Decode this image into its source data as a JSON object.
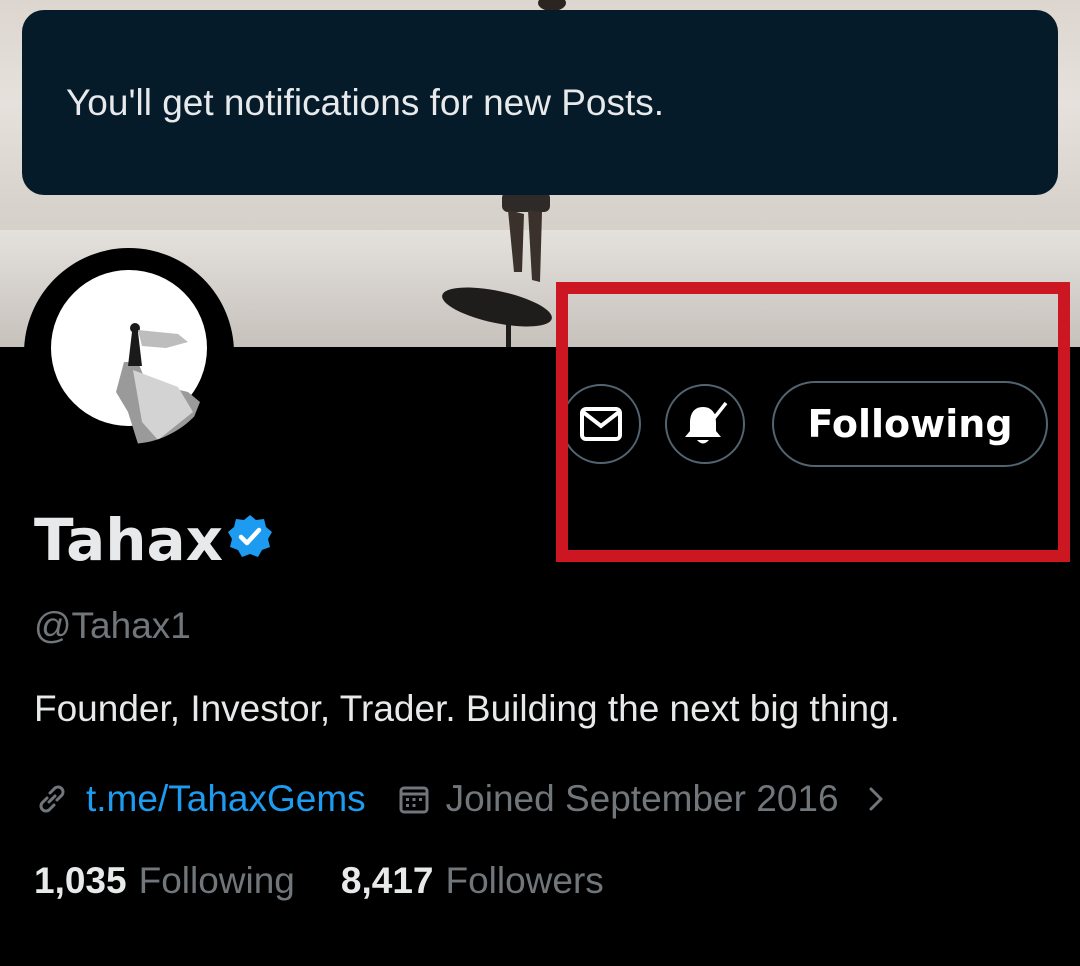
{
  "toast": {
    "message": "You'll get notifications for new Posts."
  },
  "profile": {
    "name": "Tahax",
    "handle": "@Tahax1",
    "bio": "Founder, Investor, Trader.  Building the next big thing.",
    "link": "t.me/TahaxGems",
    "joined": "Joined September 2016",
    "verified": true
  },
  "actions": {
    "message_icon": "envelope-icon",
    "notifications_icon": "bell-check-icon",
    "follow_label": "Following"
  },
  "stats": {
    "following_count": "1,035",
    "following_label": "Following",
    "followers_count": "8,417",
    "followers_label": "Followers"
  },
  "colors": {
    "accent": "#1d9bf0",
    "muted": "#71767b",
    "highlight": "#cc1622",
    "toast_bg": "#051b2a"
  }
}
